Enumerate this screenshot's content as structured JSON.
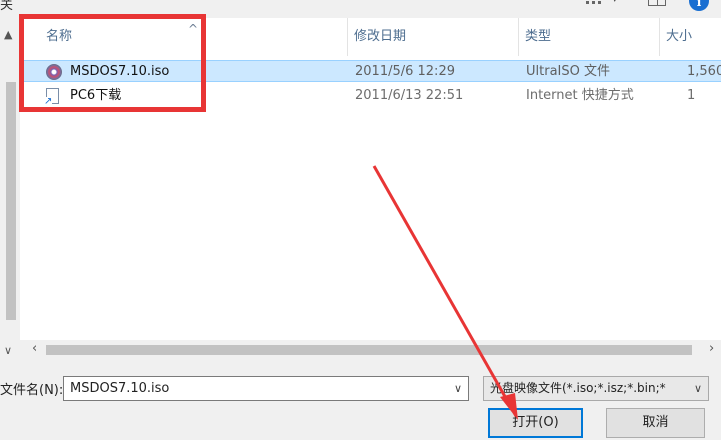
{
  "toolbar": {
    "left_glyph": "关"
  },
  "columns": {
    "name": "名称",
    "date": "修改日期",
    "type": "类型",
    "size": "大小"
  },
  "files": [
    {
      "name": "MSDOS7.10.iso",
      "date": "2011/5/6 12:29",
      "type": "UltraISO 文件",
      "size": "1,560",
      "icon": "iso-disc-icon",
      "selected": true
    },
    {
      "name": "PC6下载",
      "date": "2011/6/13 22:51",
      "type": "Internet 快捷方式",
      "size": "1",
      "icon": "internet-shortcut-icon",
      "selected": false
    }
  ],
  "footer": {
    "filename_label": "文件名(N):",
    "filename_value": "MSDOS7.10.iso",
    "filter_value": "光盘映像文件(*.iso;*.isz;*.bin;*",
    "open_label": "打开(O)",
    "cancel_label": "取消"
  },
  "annotation_color": "#e83535",
  "selection_color": "#cce8ff"
}
